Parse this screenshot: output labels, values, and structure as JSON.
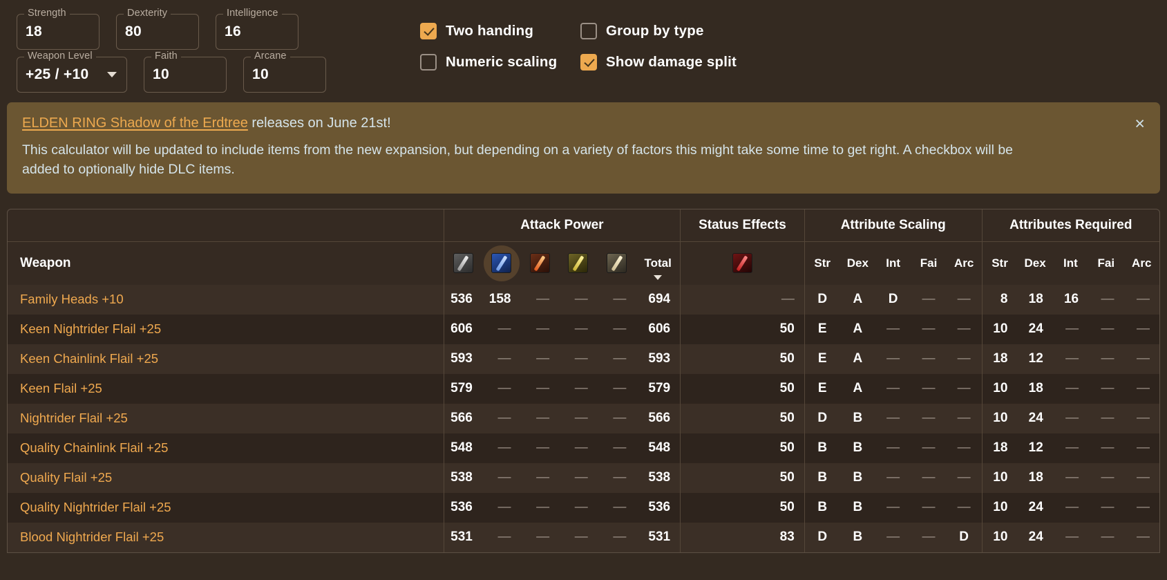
{
  "attributes": [
    {
      "label": "Strength",
      "value": "18"
    },
    {
      "label": "Dexterity",
      "value": "80"
    },
    {
      "label": "Intelligence",
      "value": "16"
    },
    {
      "label": "Faith",
      "value": "10"
    },
    {
      "label": "Arcane",
      "value": "10"
    }
  ],
  "weapon_level": {
    "label": "Weapon Level",
    "value": "+25 / +10",
    "caret_icon": "chevron-down-icon"
  },
  "checkboxes": [
    {
      "label": "Two handing",
      "checked": true,
      "name": "two-handing"
    },
    {
      "label": "Group by type",
      "checked": false,
      "name": "group-by-type"
    },
    {
      "label": "Numeric scaling",
      "checked": false,
      "name": "numeric-scaling"
    },
    {
      "label": "Show damage split",
      "checked": true,
      "name": "show-damage-split"
    }
  ],
  "banner": {
    "link_text": "ELDEN RING Shadow of the Erdtree",
    "title_rest": " releases on June 21st!",
    "body": "This calculator will be updated to include items from the new expansion, but depending on a variety of factors this might take some time to get right. A checkbox will be added to optionally hide DLC items.",
    "close_icon": "×"
  },
  "table": {
    "group_headers": [
      {
        "label": "",
        "span": 1
      },
      {
        "label": "Attack Power",
        "span": 6
      },
      {
        "label": "Status Effects",
        "span": 1
      },
      {
        "label": "Attribute Scaling",
        "span": 5
      },
      {
        "label": "Attributes Required",
        "span": 5
      }
    ],
    "weapon_col_header": "Weapon",
    "damage_icons": [
      {
        "name": "physical-damage-icon",
        "css": "ic-phys",
        "highlighted": false
      },
      {
        "name": "magic-damage-icon",
        "css": "ic-magic",
        "highlighted": true
      },
      {
        "name": "fire-damage-icon",
        "css": "ic-fire",
        "highlighted": false
      },
      {
        "name": "lightning-damage-icon",
        "css": "ic-light",
        "highlighted": false
      },
      {
        "name": "holy-damage-icon",
        "css": "ic-holy",
        "highlighted": false
      }
    ],
    "total_label": "Total",
    "sort_indicator": "descending",
    "status_icon": {
      "name": "bleed-status-icon",
      "css": "ic-bleed"
    },
    "scaling_cols": [
      "Str",
      "Dex",
      "Int",
      "Fai",
      "Arc"
    ],
    "required_cols": [
      "Str",
      "Dex",
      "Int",
      "Fai",
      "Arc"
    ],
    "rows": [
      {
        "weapon": "Family Heads +10",
        "attack": [
          "536",
          "158",
          "—",
          "—",
          "—"
        ],
        "total": "694",
        "status": "—",
        "scaling": [
          "D",
          "A",
          "D",
          "—",
          "—"
        ],
        "required": [
          "8",
          "18",
          "16",
          "—",
          "—"
        ]
      },
      {
        "weapon": "Keen Nightrider Flail +25",
        "attack": [
          "606",
          "—",
          "—",
          "—",
          "—"
        ],
        "total": "606",
        "status": "50",
        "scaling": [
          "E",
          "A",
          "—",
          "—",
          "—"
        ],
        "required": [
          "10",
          "24",
          "—",
          "—",
          "—"
        ]
      },
      {
        "weapon": "Keen Chainlink Flail +25",
        "attack": [
          "593",
          "—",
          "—",
          "—",
          "—"
        ],
        "total": "593",
        "status": "50",
        "scaling": [
          "E",
          "A",
          "—",
          "—",
          "—"
        ],
        "required": [
          "18",
          "12",
          "—",
          "—",
          "—"
        ]
      },
      {
        "weapon": "Keen Flail +25",
        "attack": [
          "579",
          "—",
          "—",
          "—",
          "—"
        ],
        "total": "579",
        "status": "50",
        "scaling": [
          "E",
          "A",
          "—",
          "—",
          "—"
        ],
        "required": [
          "10",
          "18",
          "—",
          "—",
          "—"
        ]
      },
      {
        "weapon": "Nightrider Flail +25",
        "attack": [
          "566",
          "—",
          "—",
          "—",
          "—"
        ],
        "total": "566",
        "status": "50",
        "scaling": [
          "D",
          "B",
          "—",
          "—",
          "—"
        ],
        "required": [
          "10",
          "24",
          "—",
          "—",
          "—"
        ]
      },
      {
        "weapon": "Quality Chainlink Flail +25",
        "attack": [
          "548",
          "—",
          "—",
          "—",
          "—"
        ],
        "total": "548",
        "status": "50",
        "scaling": [
          "B",
          "B",
          "—",
          "—",
          "—"
        ],
        "required": [
          "18",
          "12",
          "—",
          "—",
          "—"
        ]
      },
      {
        "weapon": "Quality Flail +25",
        "attack": [
          "538",
          "—",
          "—",
          "—",
          "—"
        ],
        "total": "538",
        "status": "50",
        "scaling": [
          "B",
          "B",
          "—",
          "—",
          "—"
        ],
        "required": [
          "10",
          "18",
          "—",
          "—",
          "—"
        ]
      },
      {
        "weapon": "Quality Nightrider Flail +25",
        "attack": [
          "536",
          "—",
          "—",
          "—",
          "—"
        ],
        "total": "536",
        "status": "50",
        "scaling": [
          "B",
          "B",
          "—",
          "—",
          "—"
        ],
        "required": [
          "10",
          "24",
          "—",
          "—",
          "—"
        ]
      },
      {
        "weapon": "Blood Nightrider Flail +25",
        "attack": [
          "531",
          "—",
          "—",
          "—",
          "—"
        ],
        "total": "531",
        "status": "83",
        "scaling": [
          "D",
          "B",
          "—",
          "—",
          "D"
        ],
        "required": [
          "10",
          "24",
          "—",
          "—",
          "—"
        ]
      }
    ]
  },
  "colors": {
    "page_bg": "#342a21",
    "accent_orange": "#eda94f",
    "weapon_name": "#f0a94f",
    "banner_bg": "#6b5632",
    "banner_text": "#d5e4ea"
  }
}
